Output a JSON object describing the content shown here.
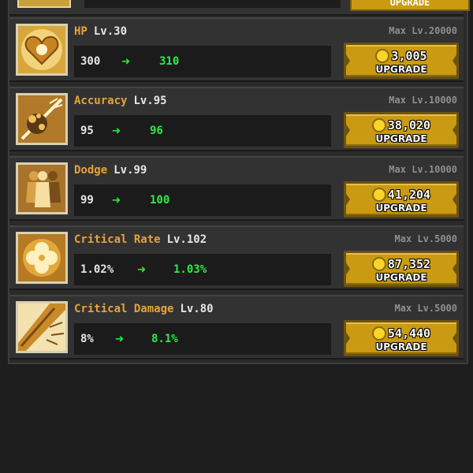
{
  "top_partial": {
    "button_label": "UPGRADE"
  },
  "stats": [
    {
      "name": "HP",
      "level": "Lv.30",
      "max_level": "Max Lv.20000",
      "current": "300",
      "next": "310",
      "cost": "3,005",
      "upgrade_label": "UPGRADE",
      "icon": "heart-icon"
    },
    {
      "name": "Accuracy",
      "level": "Lv.95",
      "max_level": "Max Lv.10000",
      "current": "95",
      "next": "96",
      "cost": "38,020",
      "upgrade_label": "UPGRADE",
      "icon": "target-hit-icon"
    },
    {
      "name": "Dodge",
      "level": "Lv.99",
      "max_level": "Max Lv.10000",
      "current": "99",
      "next": "100",
      "cost": "41,204",
      "upgrade_label": "UPGRADE",
      "icon": "dodge-silhouette-icon"
    },
    {
      "name": "Critical Rate",
      "level": "Lv.102",
      "max_level": "Max Lv.5000",
      "current": "1.02%",
      "next": "1.03%",
      "cost": "87,352",
      "upgrade_label": "UPGRADE",
      "icon": "clover-icon"
    },
    {
      "name": "Critical Damage",
      "level": "Lv.80",
      "max_level": "Max Lv.5000",
      "current": "8%",
      "next": "8.1%",
      "cost": "54,440",
      "upgrade_label": "UPGRADE",
      "icon": "blade-slash-icon"
    }
  ],
  "colors": {
    "name": "#e8a23a",
    "next_value": "#2bec44",
    "button": "#c99a12",
    "coin": "#f7d52a"
  }
}
